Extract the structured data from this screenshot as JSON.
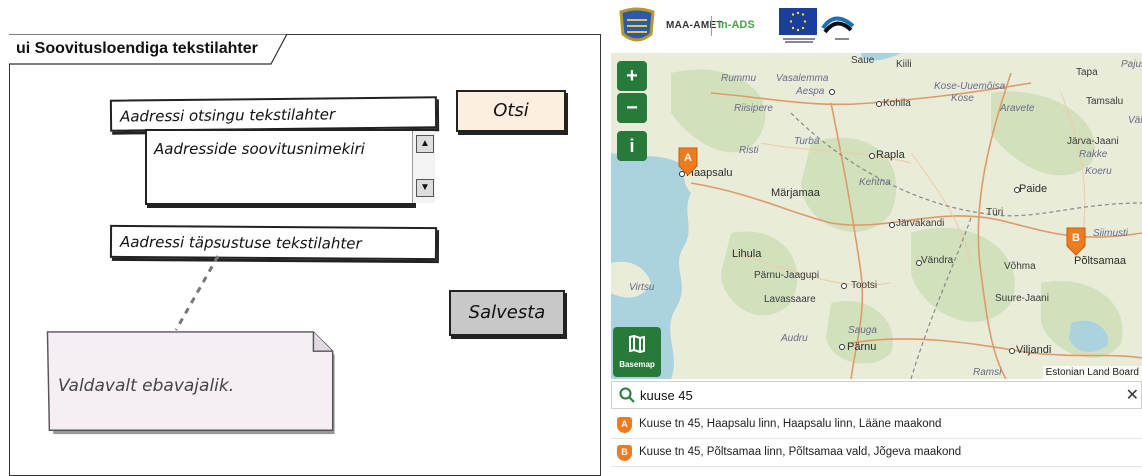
{
  "mockup": {
    "title": "ui Soovitusloendiga tekstilahter",
    "address_input_label": "Aadressi otsingu tekstilahter",
    "search_button": "Otsi",
    "suggestion_list_label": "Aadresside soovitusnimekiri",
    "precise_input_label": "Aadressi täpsustuse tekstilahter",
    "save_button": "Salvesta",
    "note_text": "Valdavalt ebavajalik."
  },
  "mapapp": {
    "header": {
      "brand": "MAA-AMET",
      "product": "In-ADS"
    },
    "controls": {
      "zoom_in": "+",
      "zoom_out": "−",
      "info": "i",
      "basemap": "Basemap"
    },
    "attribution": "Estonian Land Board",
    "markers": [
      "A",
      "B"
    ],
    "places": [
      "Rummu",
      "Vasalemma",
      "Aespa",
      "Saue",
      "Kiili",
      "Kose-Uuemõisa",
      "Kose",
      "Tapa",
      "Pajusti",
      "Riisipere",
      "Kohila",
      "Aravete",
      "Tamsalu",
      "Väike",
      "Turba",
      "Järva-Jaani",
      "Rakke",
      "Risti",
      "Rapla",
      "Koeru",
      "Haapsalu",
      "Kehtna",
      "Märjamaa",
      "Paide",
      "Türi",
      "Järvakandi",
      "Siimusti",
      "Lihula",
      "Vändra",
      "Võhma",
      "Põltsamaa",
      "Virtsu",
      "Pärnu-Jaagupi",
      "Tootsi",
      "Lavassaare",
      "Suure-Jaani",
      "Audru",
      "Sauga",
      "Pärnu",
      "Viljandi",
      "Ramsi"
    ],
    "search": {
      "value": "kuuse 45"
    },
    "results": [
      {
        "badge": "A",
        "text": "Kuuse tn 45, Haapsalu linn, Haapsalu linn, Lääne maakond"
      },
      {
        "badge": "B",
        "text": "Kuuse tn 45, Põltsamaa linn, Põltsamaa vald, Jõgeva maakond"
      }
    ],
    "colors": {
      "control_green": "#287a3b",
      "marker_orange": "#ee7b1d",
      "product_green": "#4aa34b",
      "eu_blue": "#1a3e9c"
    }
  }
}
